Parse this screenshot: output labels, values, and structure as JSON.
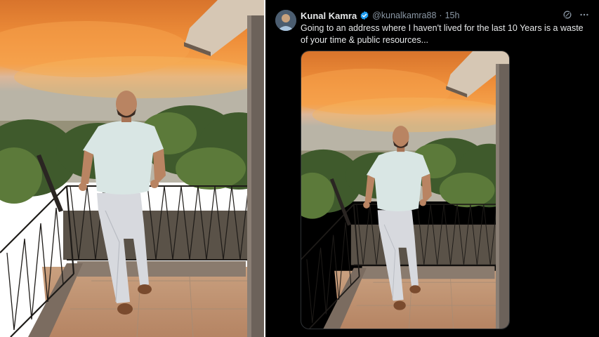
{
  "tweet": {
    "author_name": "Kunal Kamra",
    "author_handle": "@kunalkamra88",
    "separator": "·",
    "time_ago": "15h",
    "text": "Going to an address where I haven't lived for the last 10 Years is a waste of your time & public resources...",
    "verified_icon": "verified-badge-icon",
    "grok_icon": "grok-icon",
    "more_icon": "more-options-icon",
    "accent_color": "#1d9bf0"
  },
  "photo": {
    "subject": "man standing on rooftop balcony at sunset",
    "sky_top": "#e27a2a",
    "sky_mid": "#f0a04a",
    "sky_low": "#c8b8a0"
  }
}
